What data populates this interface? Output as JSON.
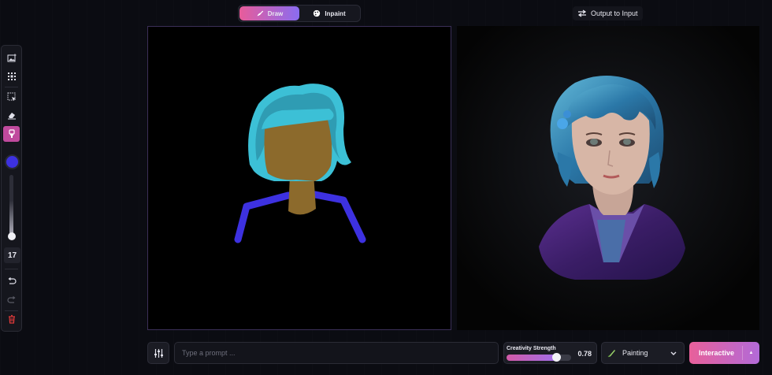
{
  "header": {
    "tabs": [
      {
        "label": "Draw",
        "icon": "brush-icon",
        "active": true
      },
      {
        "label": "Inpaint",
        "icon": "palette-icon",
        "active": false
      }
    ],
    "output_to_input_label": "Output to Input"
  },
  "toolbar": {
    "tools": [
      "image-upload-icon",
      "select-all-icon",
      "selection-icon",
      "eraser-icon",
      "brush-icon"
    ],
    "active_tool": "brush-icon",
    "brush_color": "#3d31e0",
    "brush_size": "17",
    "actions": [
      "undo-icon",
      "redo-icon",
      "delete-icon"
    ]
  },
  "bottom_bar": {
    "prompt_placeholder": "Type a prompt ...",
    "creativity_label": "Creativity Strength",
    "creativity_value": "0.78",
    "creativity_fraction": 0.78,
    "style_label": "Painting",
    "mode_label": "Interactive"
  },
  "colors": {
    "accent_start": "#e8609a",
    "accent_end": "#8a6cf0",
    "hair": "#3cc0d6",
    "skin": "#8c6a2c",
    "clothing_stroke": "#3d31e0"
  }
}
